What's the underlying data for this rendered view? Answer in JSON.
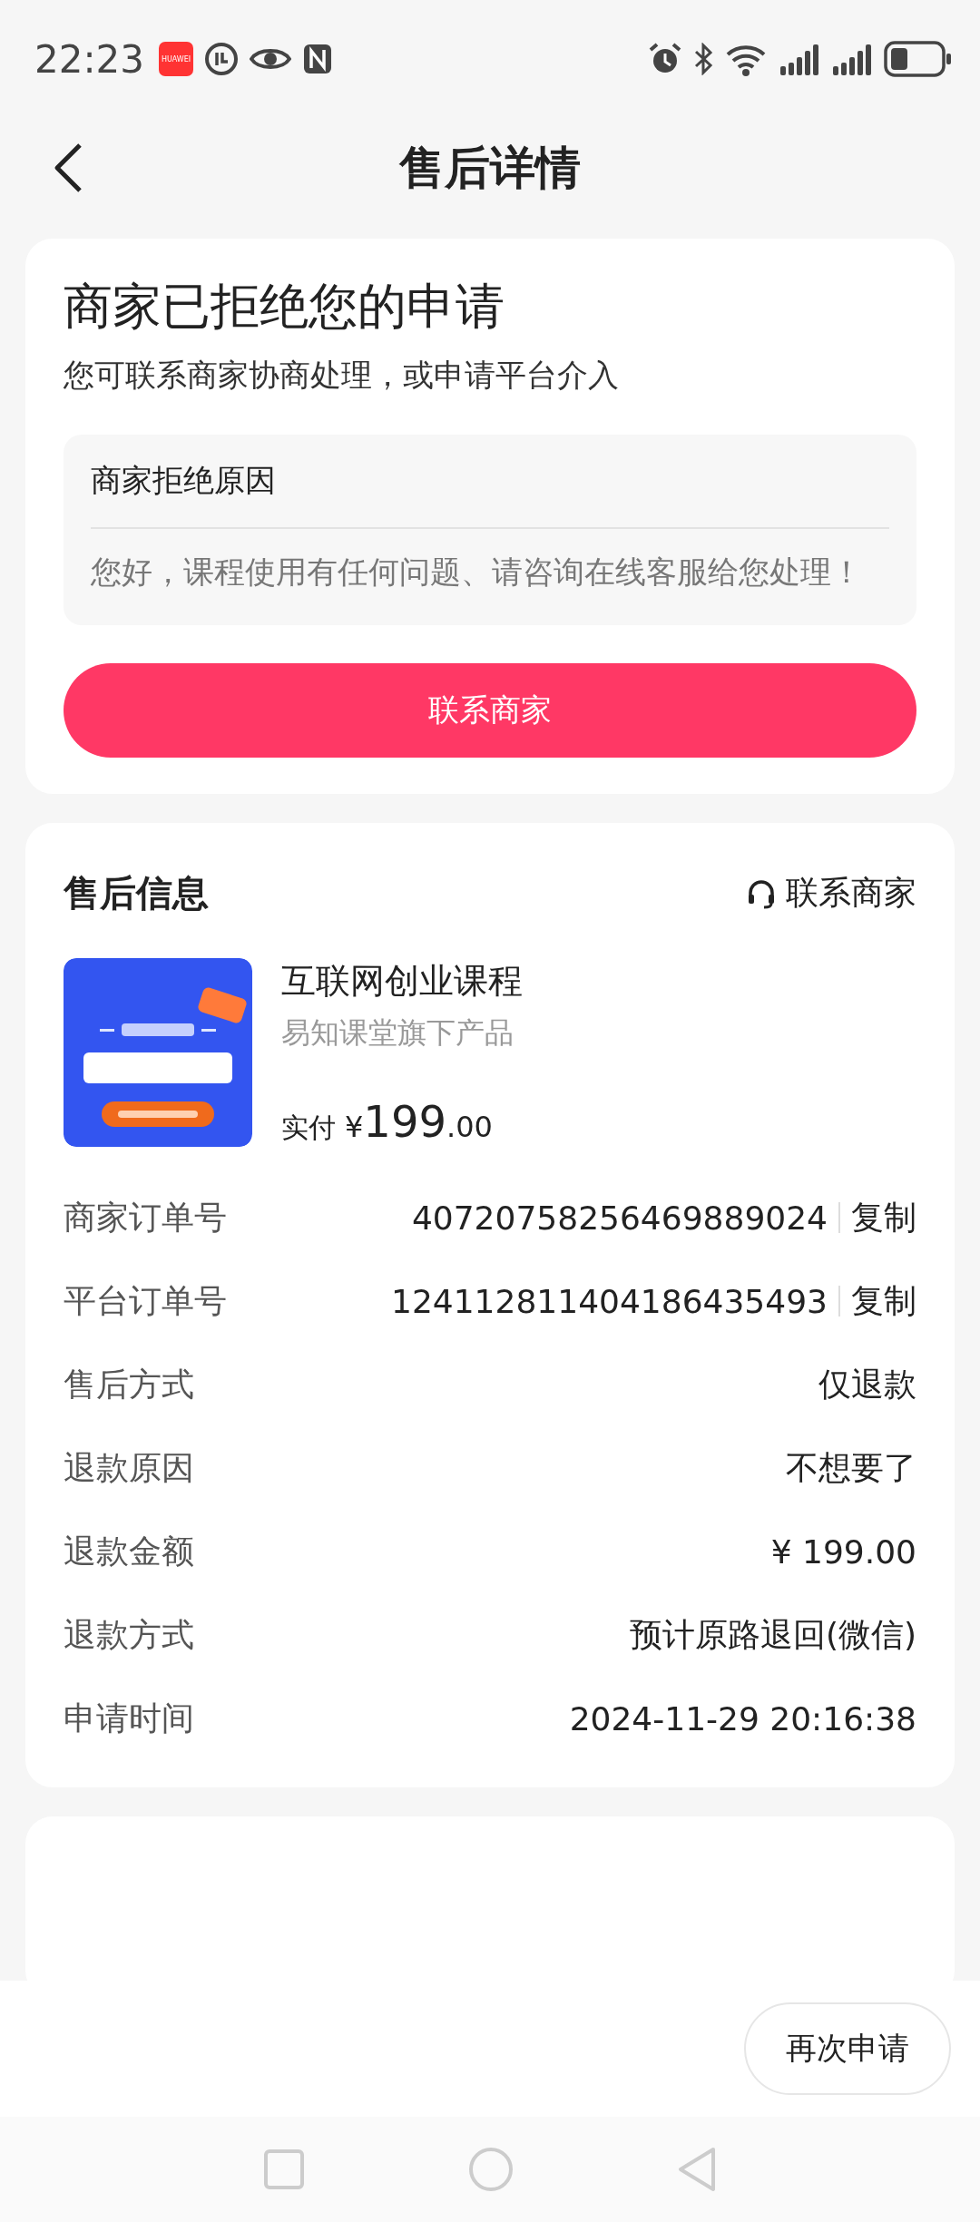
{
  "status_bar": {
    "time": "22:23",
    "app_badge": "HUAWEI"
  },
  "header": {
    "title": "售后详情"
  },
  "status_card": {
    "title": "商家已拒绝您的申请",
    "subtitle": "您可联系商家协商处理，或申请平台介入",
    "reason": {
      "label": "商家拒绝原因",
      "text": "您好，课程使用有任何问题、请咨询在线客服给您处理！"
    },
    "button": "联系商家"
  },
  "info_card": {
    "title": "售后信息",
    "contact": "联系商家",
    "product": {
      "name": "互联网创业课程",
      "seller": "易知课堂旗下产品",
      "paid_label": "实付",
      "currency": "¥",
      "price_int": "199",
      "price_dec": ".00"
    },
    "rows": [
      {
        "label": "商家订单号",
        "value": "40720758256469889024",
        "action": "复制"
      },
      {
        "label": "平台订单号",
        "value": "124112811404186435493",
        "action": "复制"
      },
      {
        "label": "售后方式",
        "value": "仅退款"
      },
      {
        "label": "退款原因",
        "value": "不想要了"
      },
      {
        "label": "退款金额",
        "value": "¥ 199.00"
      },
      {
        "label": "退款方式",
        "value": "预计原路退回(微信)"
      },
      {
        "label": "申请时间",
        "value": "2024-11-29 20:16:38"
      }
    ]
  },
  "bottom_bar": {
    "button": "再次申请"
  }
}
